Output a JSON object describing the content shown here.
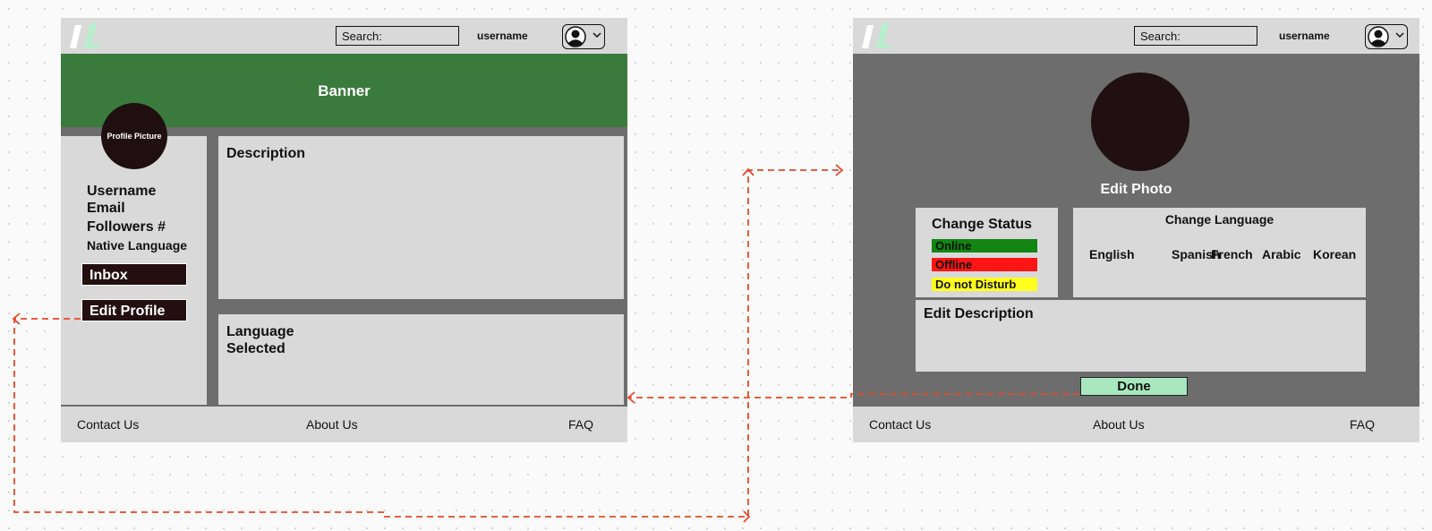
{
  "profile_page": {
    "header": {
      "search_label": "Search:",
      "username": "username"
    },
    "banner": "Banner",
    "profile_picture": "Profile Picture",
    "info": {
      "username": "Username",
      "email": "Email",
      "followers": "Followers #",
      "native_language": "Native Language"
    },
    "buttons": {
      "inbox": "Inbox",
      "edit_profile": "Edit Profile"
    },
    "description_title": "Description",
    "language_selected_line1": "Language",
    "language_selected_line2": "Selected",
    "footer": {
      "contact": "Contact Us",
      "about": "About Us",
      "faq": "FAQ"
    }
  },
  "edit_page": {
    "header": {
      "search_label": "Search:",
      "username": "username"
    },
    "edit_photo": "Edit Photo",
    "status": {
      "title": "Change Status",
      "options": [
        {
          "label": "Online",
          "color": "#128512"
        },
        {
          "label": "Offline",
          "color": "#ff1515"
        },
        {
          "label": "Do not Disturb",
          "color": "#ffff1f"
        }
      ]
    },
    "language": {
      "title": "Change Language",
      "options": [
        "English",
        "Spanish",
        "French",
        "Arabic",
        "Korean"
      ]
    },
    "edit_description": "Edit Description",
    "done": "Done",
    "footer": {
      "contact": "Contact Us",
      "about": "About Us",
      "faq": "FAQ"
    }
  },
  "colors": {
    "banner": "#3a7a3c",
    "frame_bg": "#6d6d6d",
    "panel_bg": "#d9d9d9",
    "dark_button": "#230f10",
    "done_button": "#a9e8bf",
    "flow_arrow": "#e8492a"
  }
}
